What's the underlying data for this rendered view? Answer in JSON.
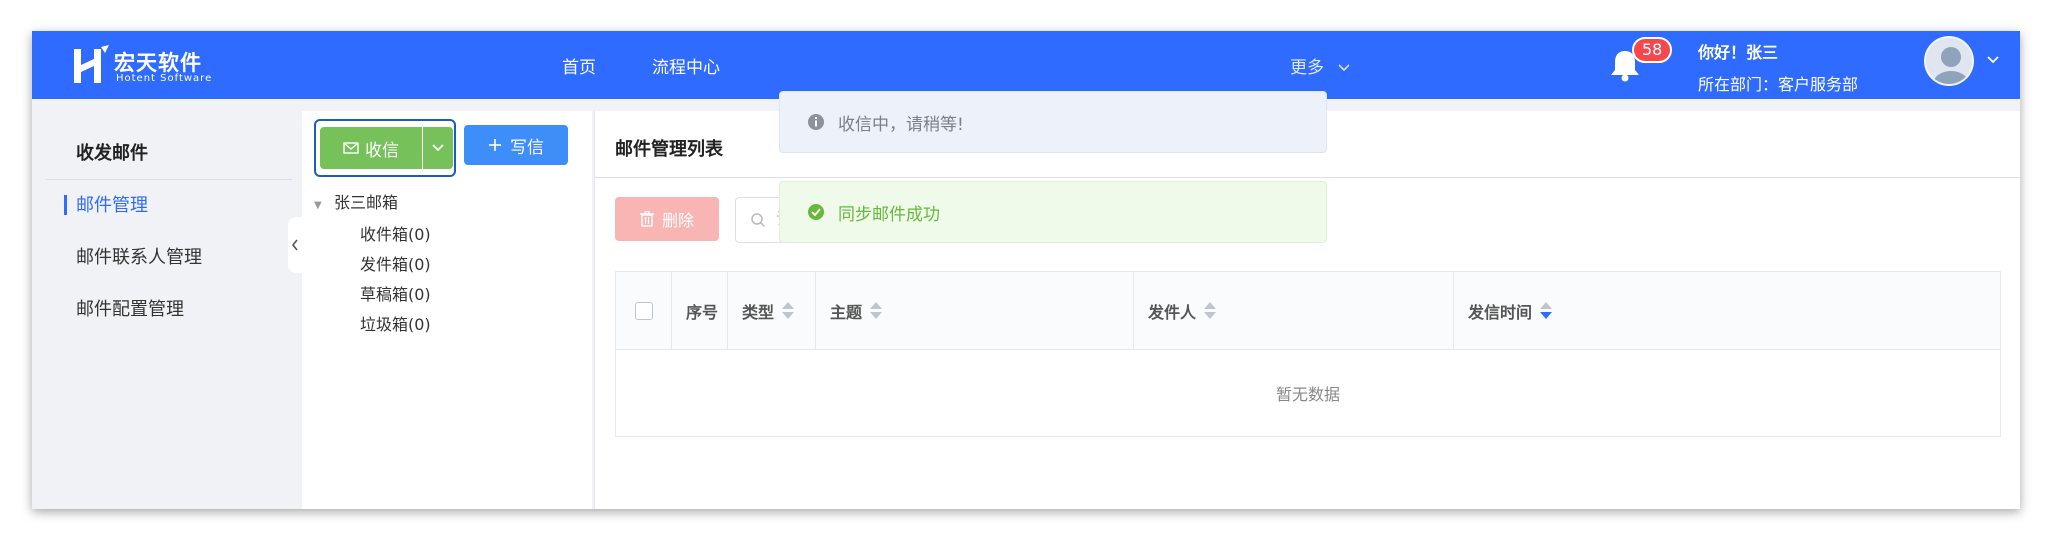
{
  "header": {
    "logo_cn": "宏天软件",
    "logo_en": "Hotent Software",
    "nav": [
      "首页",
      "流程中心"
    ],
    "more": "更多",
    "notification_count": "58",
    "greeting": "你好！张三",
    "department": "所在部门：客户服务部"
  },
  "leftnav": {
    "title": "收发邮件",
    "items": [
      {
        "label": "邮件管理",
        "active": true
      },
      {
        "label": "邮件联系人管理"
      },
      {
        "label": "邮件配置管理"
      }
    ]
  },
  "toolbar": {
    "receive_label": "收信",
    "write_label": "写信"
  },
  "tree": {
    "root": "张三邮箱",
    "folders": [
      "收件箱(0)",
      "发件箱(0)",
      "草稿箱(0)",
      "垃圾箱(0)"
    ]
  },
  "main": {
    "title": "邮件管理列表",
    "delete_label": "删除",
    "search_placeholder": "请输入关键词 主题/发送人",
    "columns": [
      "序号",
      "类型",
      "主题",
      "发件人",
      "发信时间"
    ],
    "empty_text": "暂无数据"
  },
  "toasts": {
    "info": "收信中，请稍等!",
    "success": "同步邮件成功"
  },
  "colors": {
    "primary": "#2f6bff",
    "success": "#76c15a",
    "danger_disabled": "#f9b4b4",
    "badge": "#f5484d"
  }
}
